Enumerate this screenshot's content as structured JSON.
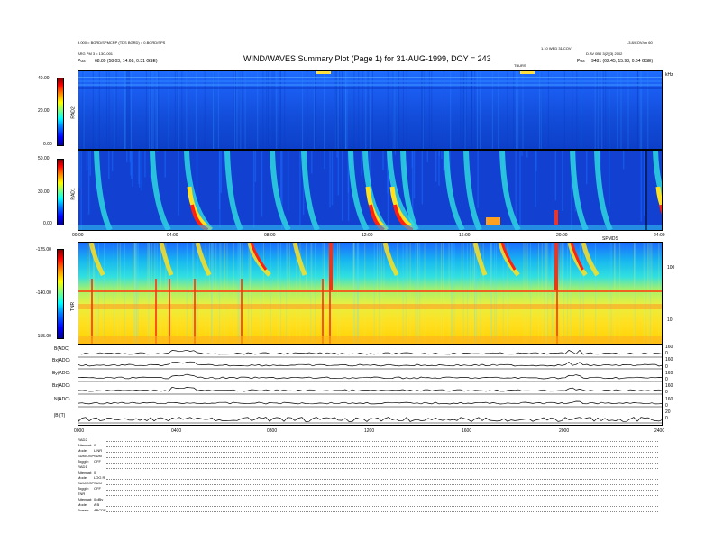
{
  "header": {
    "title": "WIND/WAVES Summary Plot (Page 1) for 31-AUG-1999, DOY = 243",
    "left_line1": "9.000 = BGRD/SPMCRP (TDS BGRD) = 0.BGRD/SPS",
    "left_line2": "ARG PM 3 = 13C-001",
    "left_pos_label": "Pos",
    "left_pos_value": "68.89 (58.03, 14.68, 0.31 GSE)",
    "right_line0": "L3.8/COV/on 60",
    "right_line1": "1.10 WED 31/COV",
    "right_line2": "D.AV  0B0 3(2)(3) 2002",
    "right_pos_label": "Pos",
    "right_pos_value": "9481 (62.45, 15.98, 0.64 GSE)",
    "upper_right_mark": "TBURS"
  },
  "chart_data": [
    {
      "type": "heatmap",
      "panel": "RAD2",
      "ylabel": "RAD2",
      "y_ticks": [
        "40.00",
        "20.00",
        "0.00"
      ],
      "ylim": [
        0,
        40
      ],
      "colorbar": "jet",
      "right_mark": "kHz"
    },
    {
      "type": "heatmap",
      "panel": "RAD1",
      "ylabel": "RAD1",
      "y_ticks": [
        "50.00",
        "30.00",
        "0.00"
      ],
      "ylim": [
        0,
        50
      ],
      "colorbar": "jet",
      "x_ticks": [
        "00:00",
        "04:00",
        "08:00",
        "12:00",
        "16:00",
        "20:00",
        "24:00"
      ],
      "right_mark": "SPMDS"
    },
    {
      "type": "heatmap",
      "panel": "TNR",
      "ylabel": "TNR",
      "y_ticks": [
        "-125.00",
        "-140.00",
        "-155.00"
      ],
      "ylim": [
        -155,
        -125
      ],
      "colorbar": "jet",
      "right_ticks": [
        "100",
        "10"
      ]
    },
    {
      "type": "line",
      "panel": "MAG",
      "series": [
        {
          "name": "B (ADC)",
          "label": "B(ADC)"
        },
        {
          "name": "Bx (ADC)",
          "label": "Bx(ADC)"
        },
        {
          "name": "By (ADC)",
          "label": "By(ADC)"
        },
        {
          "name": "Bz (ADC)",
          "label": "Bz(ADC)"
        },
        {
          "name": "N (ADC)",
          "label": "N(ADC)"
        },
        {
          "name": "|B| (T)",
          "label": "|B|(T)"
        }
      ],
      "x_ticks": [
        "0000",
        "0400",
        "0800",
        "1200",
        "1600",
        "2000",
        "2400"
      ],
      "right_ticks": [
        "160",
        "0",
        "160",
        "0",
        "160",
        "0",
        "160",
        "0",
        "160",
        "0",
        "20",
        "0"
      ]
    }
  ],
  "footer": {
    "groups": [
      {
        "head": "RAD2",
        "rows": [
          [
            "Attenuat:",
            "0"
          ],
          [
            "Mode:",
            "LINR"
          ],
          [
            "SUM/DSP:",
            "SUM"
          ],
          [
            "Toggle:",
            "OFF"
          ]
        ]
      },
      {
        "head": "RAD1",
        "rows": [
          [
            "Attenuat:",
            "0"
          ],
          [
            "Mode:",
            "LOG R"
          ],
          [
            "SUM/DSP:",
            "SUM"
          ],
          [
            "Toggle:",
            "OFF"
          ]
        ]
      },
      {
        "head": "TNR",
        "rows": [
          [
            "Attenuat:",
            "0 dBy"
          ],
          [
            "Mode:",
            "A B"
          ],
          [
            "Sweep:",
            "ABCDE"
          ]
        ]
      }
    ]
  }
}
